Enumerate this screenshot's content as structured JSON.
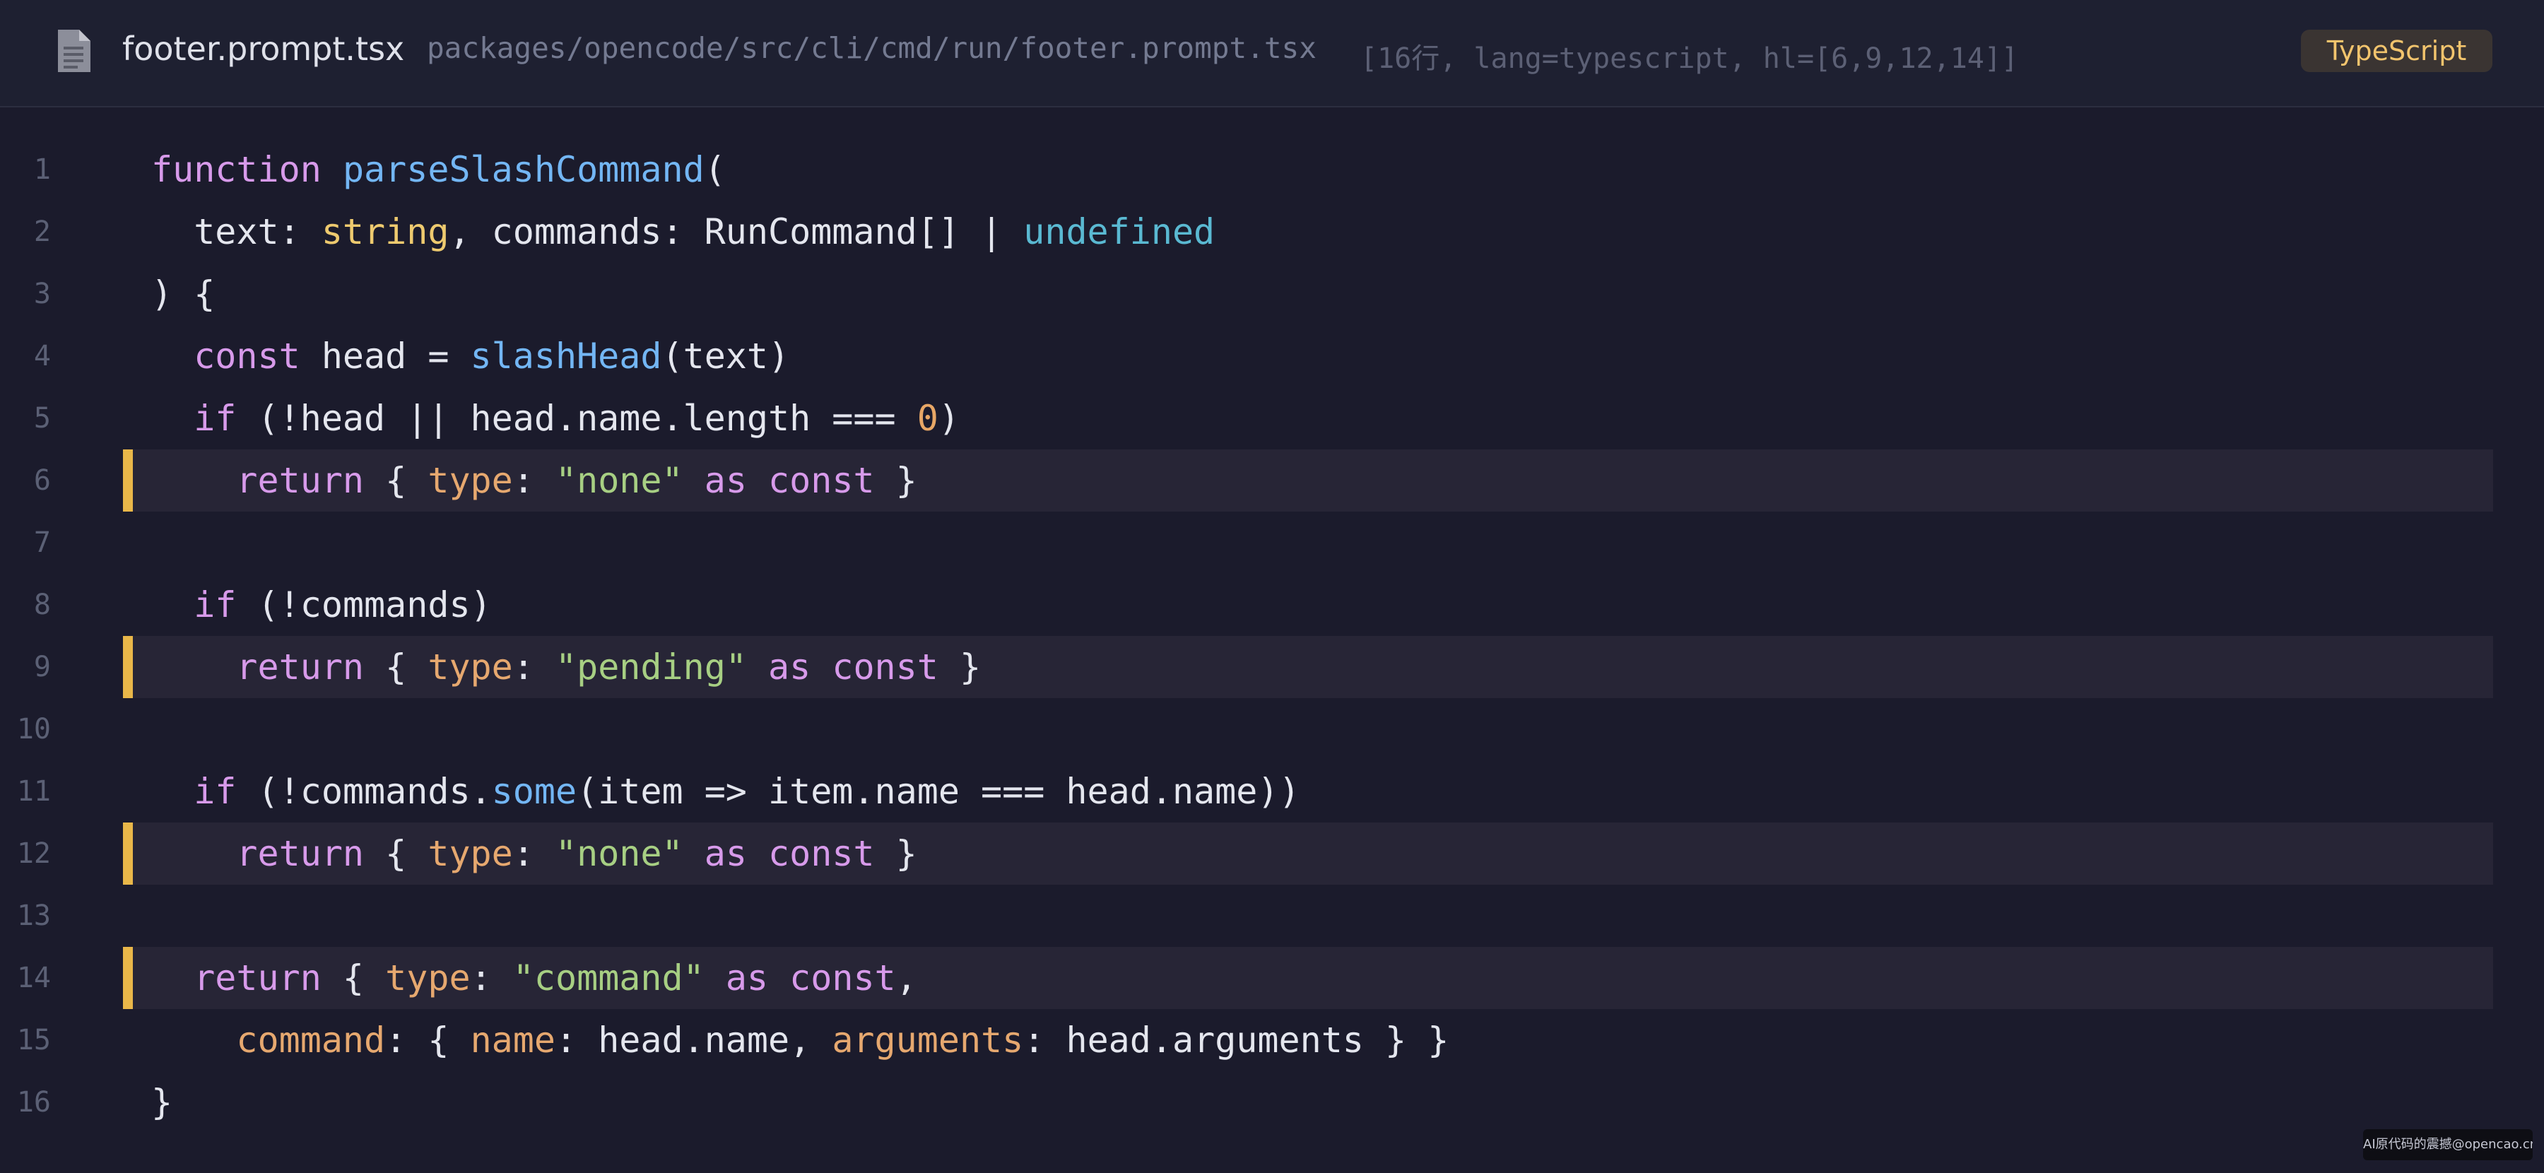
{
  "header": {
    "file_icon": "file-icon",
    "file_name": "footer.prompt.tsx",
    "file_path": "packages/opencode/src/cli/cmd/run/footer.prompt.tsx",
    "meta": "[16行, lang=typescript, hl=[6,9,12,14]]",
    "language": "TypeScript"
  },
  "colors": {
    "background": "#1b1b2c",
    "keyword": "#d79aea",
    "function": "#73b6f4",
    "type": "#eeca6f",
    "undefined": "#5ab9d2",
    "string": "#a7cf83",
    "number": "#e8a766",
    "property": "#e6a86f",
    "highlight_bar": "#e9b749"
  },
  "code": {
    "highlighted_lines": [
      6,
      9,
      12,
      14
    ],
    "lines": [
      {
        "n": "1",
        "tokens": [
          [
            "kw",
            "function"
          ],
          [
            "p",
            " "
          ],
          [
            "fn",
            "parseSlashCommand"
          ],
          [
            "p",
            "("
          ]
        ]
      },
      {
        "n": "2",
        "tokens": [
          [
            "p",
            "  text: "
          ],
          [
            "ty",
            "string"
          ],
          [
            "p",
            ", commands: RunCommand[] | "
          ],
          [
            "un",
            "undefined"
          ]
        ]
      },
      {
        "n": "3",
        "tokens": [
          [
            "p",
            ") {"
          ]
        ]
      },
      {
        "n": "4",
        "tokens": [
          [
            "kw",
            "  const"
          ],
          [
            "p",
            " head = "
          ],
          [
            "fn",
            "slashHead"
          ],
          [
            "p",
            "(text)"
          ]
        ]
      },
      {
        "n": "5",
        "tokens": [
          [
            "kw",
            "  if"
          ],
          [
            "p",
            " (!head || head.name.length === "
          ],
          [
            "num",
            "0"
          ],
          [
            "p",
            ")"
          ]
        ]
      },
      {
        "n": "6",
        "tokens": [
          [
            "kw",
            "    return"
          ],
          [
            "p",
            " { "
          ],
          [
            "prop",
            "type"
          ],
          [
            "p",
            ": "
          ],
          [
            "str",
            "\"none\""
          ],
          [
            "p",
            " "
          ],
          [
            "kw",
            "as const"
          ],
          [
            "p",
            " }"
          ]
        ]
      },
      {
        "n": "7",
        "tokens": []
      },
      {
        "n": "8",
        "tokens": [
          [
            "kw",
            "  if"
          ],
          [
            "p",
            " (!commands)"
          ]
        ]
      },
      {
        "n": "9",
        "tokens": [
          [
            "kw",
            "    return"
          ],
          [
            "p",
            " { "
          ],
          [
            "prop",
            "type"
          ],
          [
            "p",
            ": "
          ],
          [
            "str",
            "\"pending\""
          ],
          [
            "p",
            " "
          ],
          [
            "kw",
            "as const"
          ],
          [
            "p",
            " }"
          ]
        ]
      },
      {
        "n": "10",
        "tokens": []
      },
      {
        "n": "11",
        "tokens": [
          [
            "kw",
            "  if"
          ],
          [
            "p",
            " (!commands."
          ],
          [
            "fn",
            "some"
          ],
          [
            "p",
            "(item => item.name === head.name))"
          ]
        ]
      },
      {
        "n": "12",
        "tokens": [
          [
            "kw",
            "    return"
          ],
          [
            "p",
            " { "
          ],
          [
            "prop",
            "type"
          ],
          [
            "p",
            ": "
          ],
          [
            "str",
            "\"none\""
          ],
          [
            "p",
            " "
          ],
          [
            "kw",
            "as const"
          ],
          [
            "p",
            " }"
          ]
        ]
      },
      {
        "n": "13",
        "tokens": []
      },
      {
        "n": "14",
        "tokens": [
          [
            "kw",
            "  return"
          ],
          [
            "p",
            " { "
          ],
          [
            "prop",
            "type"
          ],
          [
            "p",
            ": "
          ],
          [
            "str",
            "\"command\""
          ],
          [
            "p",
            " "
          ],
          [
            "kw",
            "as const"
          ],
          [
            "p",
            ","
          ]
        ]
      },
      {
        "n": "15",
        "tokens": [
          [
            "prop",
            "    command"
          ],
          [
            "p",
            ": { "
          ],
          [
            "prop",
            "name"
          ],
          [
            "p",
            ": head.name, "
          ],
          [
            "prop",
            "arguments"
          ],
          [
            "p",
            ": head.arguments } }"
          ]
        ]
      },
      {
        "n": "16",
        "tokens": [
          [
            "p",
            "}"
          ]
        ]
      }
    ]
  },
  "watermark": "AI原代码的震撼@opencao.cn"
}
